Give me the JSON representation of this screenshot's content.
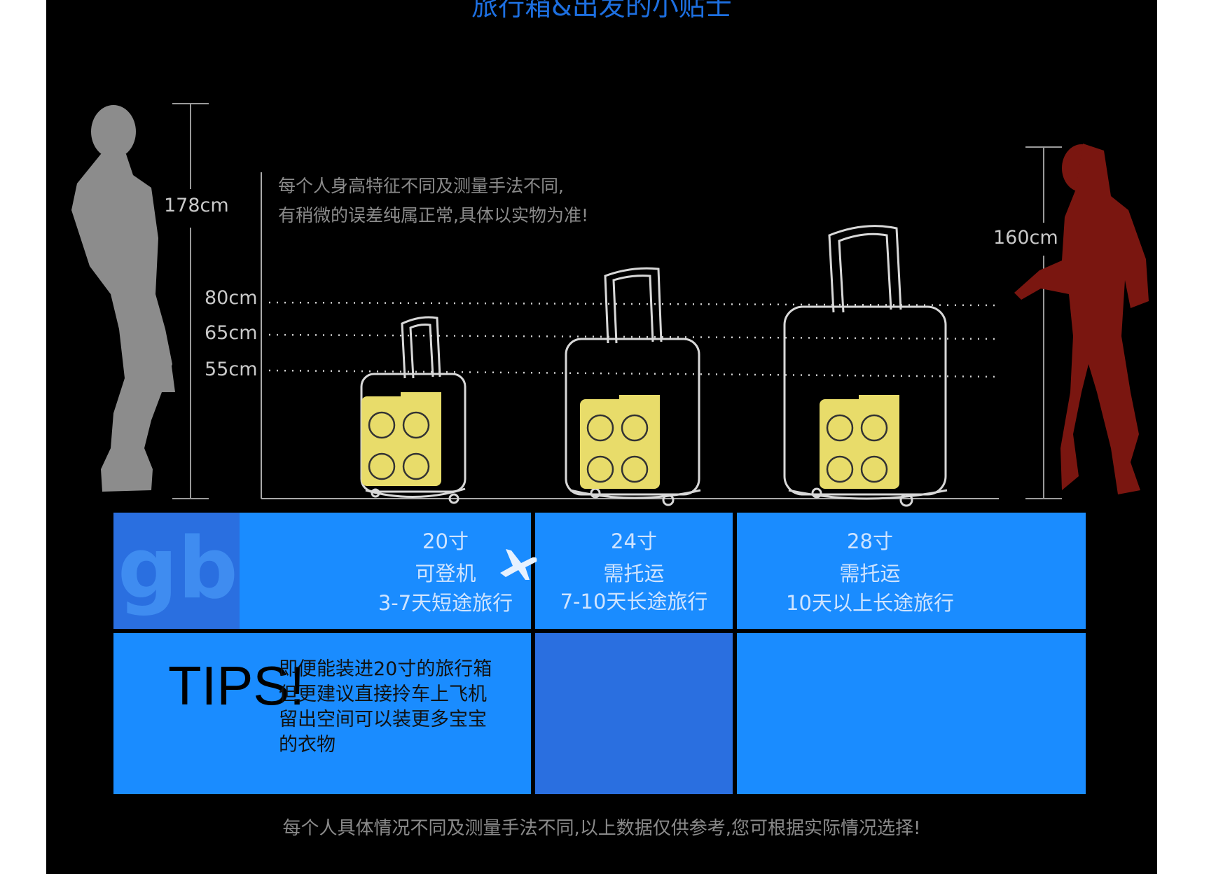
{
  "header": {
    "title": "旅行箱&出发的小贴士"
  },
  "note": {
    "line1": "每个人身高特征不同及测量手法不同,",
    "line2": "有稍微的误差纯属正常,具体以实物为准!"
  },
  "measurements": {
    "male_height": "178cm",
    "female_height": "160cm",
    "lines": [
      "80cm",
      "65cm",
      "55cm"
    ]
  },
  "logo": {
    "text": "gb"
  },
  "suitcases": [
    {
      "size": "20寸",
      "note": "可登机",
      "trip": "3-7天短途旅行",
      "icon": "airplane-icon"
    },
    {
      "size": "24寸",
      "note": "需托运",
      "trip": "7-10天长途旅行"
    },
    {
      "size": "28寸",
      "note": "需托运",
      "trip": "10天以上长途旅行"
    }
  ],
  "tips": {
    "title": "TIPS!",
    "lines": [
      "即便能装进20寸的旅行箱",
      "但更建议直接拎车上飞机",
      "留出空间可以装更多宝宝",
      "的衣物"
    ]
  },
  "footer": {
    "text": "每个人具体情况不同及测量手法不同,以上数据仅供参考,您可根据实际情况选择!"
  },
  "colors": {
    "background": "#000000",
    "cell_blue": "#1a8cff",
    "cell_dark_blue": "#2a6fe0",
    "logo_block": "#2a6fe0",
    "male_silhouette": "#8c8c8c",
    "female_silhouette": "#7a1610",
    "wheel_yellow": "#e8dc6a"
  }
}
